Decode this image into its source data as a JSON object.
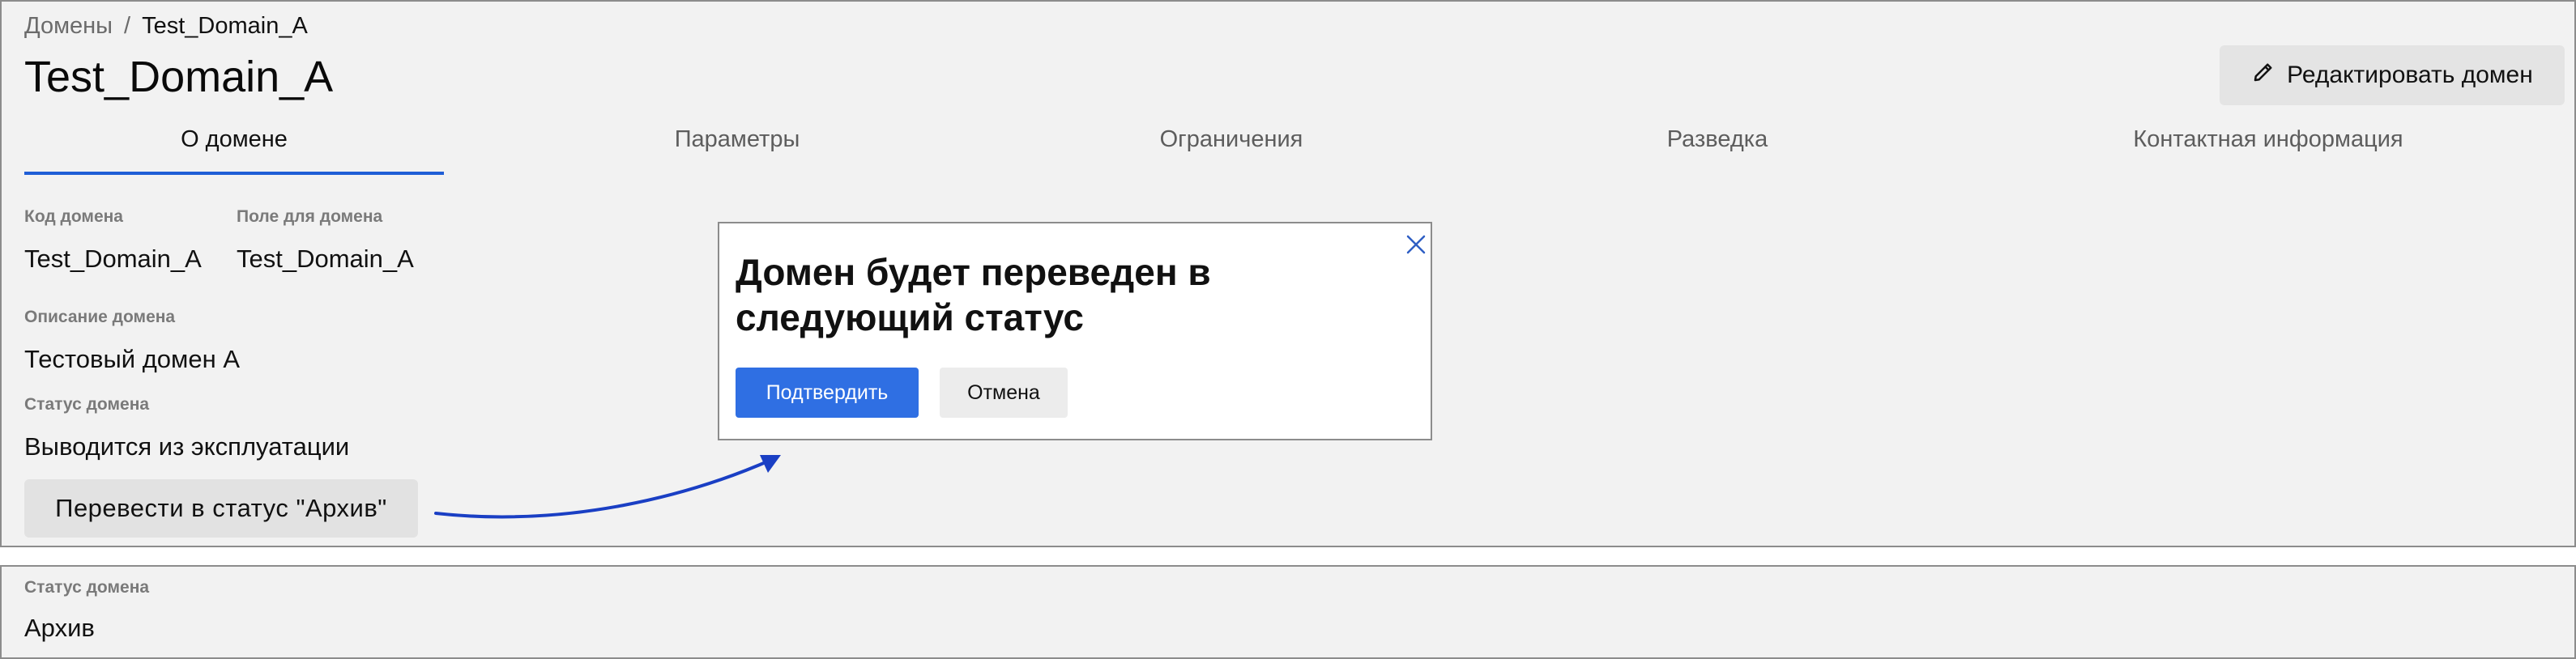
{
  "breadcrumb": {
    "parent": "Домены",
    "separator": "/",
    "current": "Test_Domain_A"
  },
  "page_title": "Test_Domain_A",
  "header": {
    "edit_label": "Редактировать домен",
    "edit_icon": "pencil-icon"
  },
  "tabs": [
    {
      "label": "О домене",
      "active": true
    },
    {
      "label": "Параметры",
      "active": false
    },
    {
      "label": "Ограничения",
      "active": false
    },
    {
      "label": "Разведка",
      "active": false
    },
    {
      "label": "Контактная информация",
      "active": false
    }
  ],
  "fields": {
    "code": {
      "label": "Код домена",
      "value": "Test_Domain_A"
    },
    "field": {
      "label": "Поле для домена",
      "value": "Test_Domain_A"
    },
    "description": {
      "label": "Описание домена",
      "value": "Тестовый домен А"
    },
    "status": {
      "label": "Статус домена",
      "value": "Выводится из эксплуатации"
    }
  },
  "status_action_label": "Перевести в статус \"Архив\"",
  "dialog": {
    "title": "Домен будет переведен в следующий статус",
    "confirm_label": "Подтвердить",
    "cancel_label": "Отмена",
    "close_icon": "close-icon"
  },
  "result": {
    "status_label": "Статус домена",
    "status_value": "Архив"
  },
  "colors": {
    "accent": "#1f5ed6",
    "confirm_button": "#2f6fe3",
    "panel_bg": "#f2f2f2",
    "arrow": "#1a3fc4"
  }
}
